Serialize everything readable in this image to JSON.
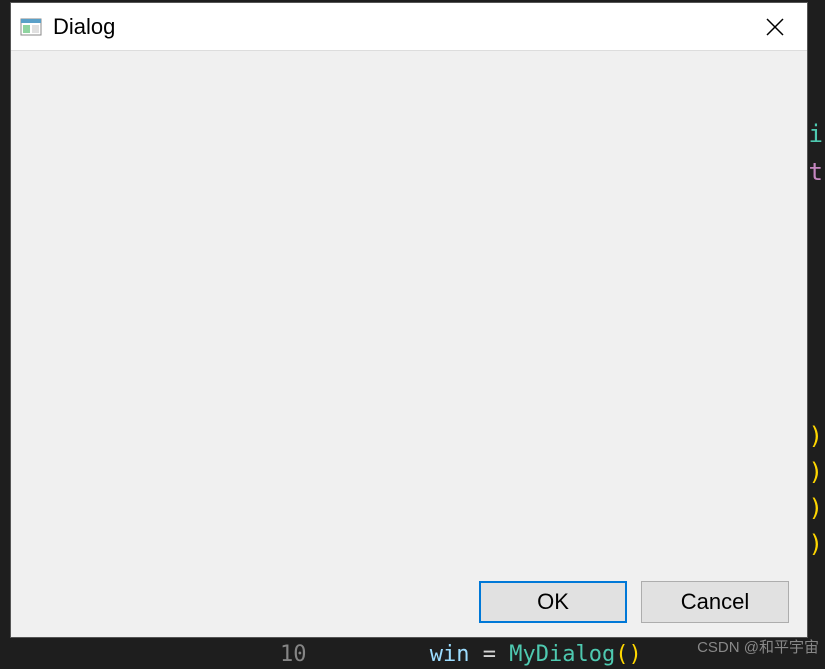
{
  "dialog": {
    "title": "Dialog",
    "ok_label": "OK",
    "cancel_label": "Cancel"
  },
  "background_code": {
    "frag_i": "i",
    "frag_t": "t",
    "frag_paren": ")",
    "line_num": "10",
    "var": "win",
    "op": " = ",
    "fn": "MyDialog",
    "parens": "()"
  },
  "watermark": "CSDN @和平宇宙"
}
